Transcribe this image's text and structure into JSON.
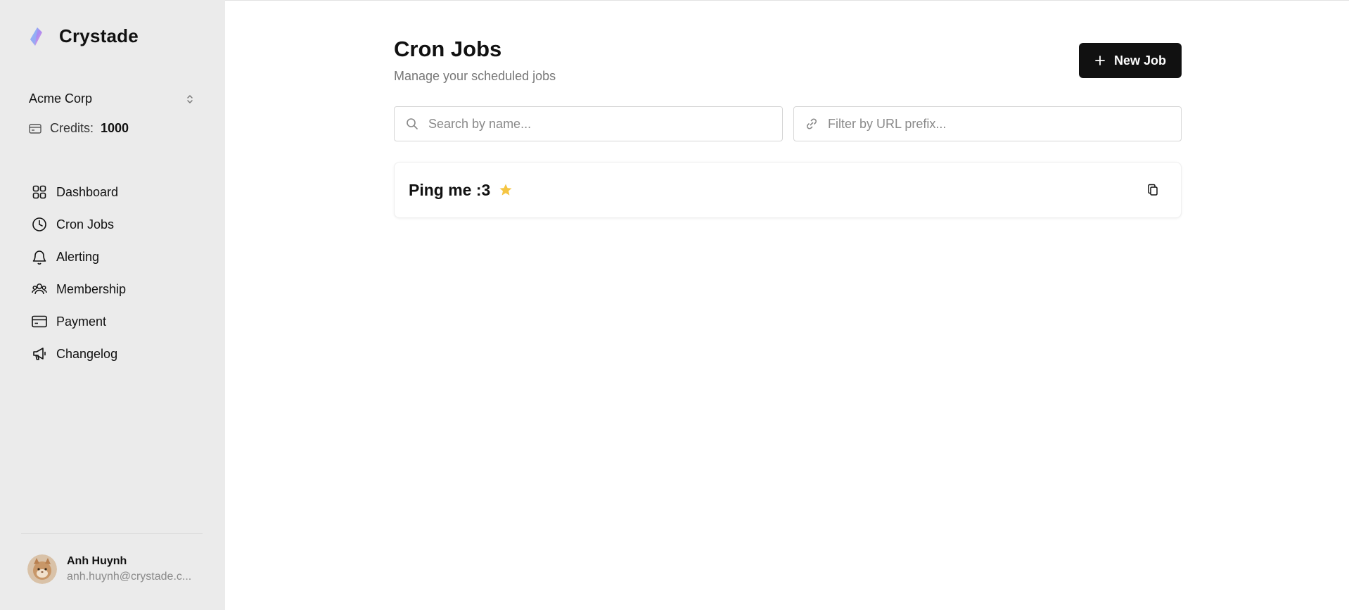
{
  "app": {
    "name": "Crystade",
    "logo_icon": "crystal-logo-icon"
  },
  "org": {
    "name": "Acme Corp",
    "chevron_icon": "chevron-up-down-icon"
  },
  "credits": {
    "label": "Credits:",
    "value": "1000",
    "icon": "credit-card-icon"
  },
  "sidebar": {
    "items": [
      {
        "label": "Dashboard",
        "icon": "grid-icon"
      },
      {
        "label": "Cron Jobs",
        "icon": "clock-icon"
      },
      {
        "label": "Alerting",
        "icon": "bell-icon"
      },
      {
        "label": "Membership",
        "icon": "users-icon"
      },
      {
        "label": "Payment",
        "icon": "credit-card-icon"
      },
      {
        "label": "Changelog",
        "icon": "megaphone-icon"
      }
    ]
  },
  "user": {
    "name": "Anh Huynh",
    "email": "anh.huynh@crystade.c..."
  },
  "page": {
    "title": "Cron Jobs",
    "subtitle": "Manage your scheduled jobs"
  },
  "actions": {
    "new_job_label": "New Job",
    "new_job_icon": "plus-icon"
  },
  "filters": {
    "search_placeholder": "Search by name...",
    "search_value": "",
    "url_placeholder": "Filter by URL prefix...",
    "url_value": ""
  },
  "jobs": [
    {
      "name": "Ping me :3",
      "favorite": true,
      "star_color": "#f5c542"
    }
  ],
  "colors": {
    "sidebar_bg": "#ebebeb",
    "primary": "#111111",
    "star": "#f5c542"
  }
}
